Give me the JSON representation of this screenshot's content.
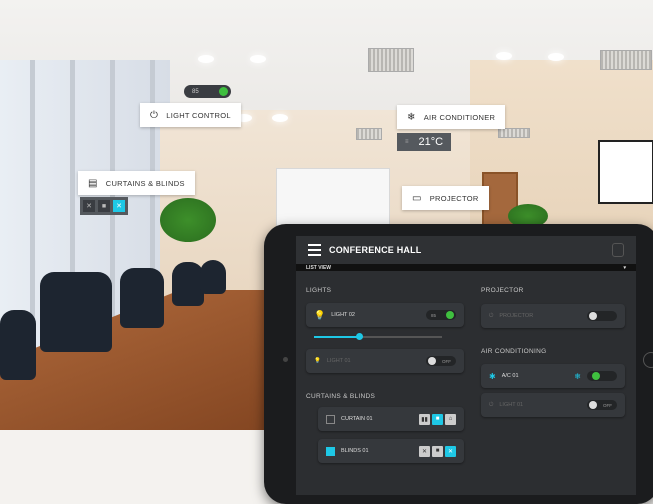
{
  "overlay": {
    "light_control": {
      "label": "LIGHT CONTROL",
      "pill_value": "85"
    },
    "air_conditioner": {
      "label": "AIR CONDITIONER",
      "temperature": "21°C"
    },
    "curtains": {
      "label": "CURTAINS & BLINDS"
    },
    "projector": {
      "label": "PROJECTOR"
    }
  },
  "app": {
    "title": "CONFERENCE HALL",
    "view_label": "LIST VIEW",
    "sections": {
      "lights": "LIGHTS",
      "projector": "PROJECTOR",
      "air_conditioning": "AIR CONDITIONING",
      "curtains": "CURTAINS & BLINDS"
    },
    "lights": [
      {
        "name": "LIGHT 02",
        "value": "85",
        "state": "on",
        "level_percent": 35
      },
      {
        "name": "LIGHT 01",
        "value": "OFF",
        "state": "off"
      }
    ],
    "projector_item": {
      "name": "PROJECTOR",
      "state": "off"
    },
    "ac_items": [
      {
        "name": "A/C 01",
        "state": "on"
      },
      {
        "name": "LIGHT 01",
        "value": "OFF",
        "state": "off"
      }
    ],
    "curtain_items": [
      {
        "name": "CURTAIN 01",
        "checked": false,
        "active": 1
      },
      {
        "name": "BLINDS 01",
        "checked": true,
        "active": 2
      }
    ]
  },
  "colors": {
    "accent": "#1ec8e6",
    "on": "#3fbf3f"
  }
}
